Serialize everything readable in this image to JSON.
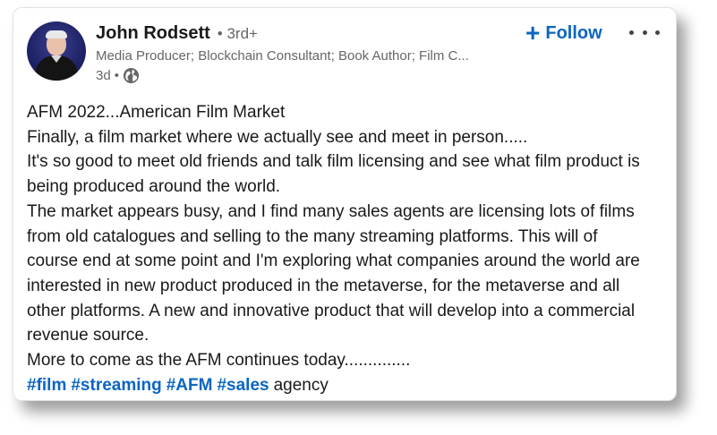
{
  "author": {
    "name": "John Rodsett",
    "degree": "• 3rd+",
    "headline": "Media Producer; Blockchain Consultant; Book Author; Film C...",
    "time": "3d",
    "time_sep": "•",
    "visibility_icon": "globe-icon"
  },
  "actions": {
    "follow_plus": "+",
    "follow_label": "Follow",
    "more_icon": "ellipsis-icon"
  },
  "post": {
    "lines": [
      "AFM 2022...American Film Market",
      "Finally, a film market where we actually see and meet in person.....",
      "It's so good to meet old friends and talk film licensing and see what film product is",
      "being produced around the world.",
      "The market appears busy, and I find many sales agents are licensing lots of films",
      "from old catalogues and selling to the many streaming platforms. This will of",
      "course end at some point and I'm exploring what companies around the world are",
      "interested in new product produced in the metaverse, for the metaverse and all",
      "other platforms. A new and innovative product that will develop into a commercial",
      "revenue source.",
      "More to come as the AFM continues today.............."
    ],
    "hashtags": [
      "#film",
      "#streaming",
      "#AFM",
      "#sales"
    ],
    "trailing_word": "agency"
  },
  "colors": {
    "link_blue": "#0a66c2",
    "text": "#191919",
    "muted": "#666666"
  }
}
